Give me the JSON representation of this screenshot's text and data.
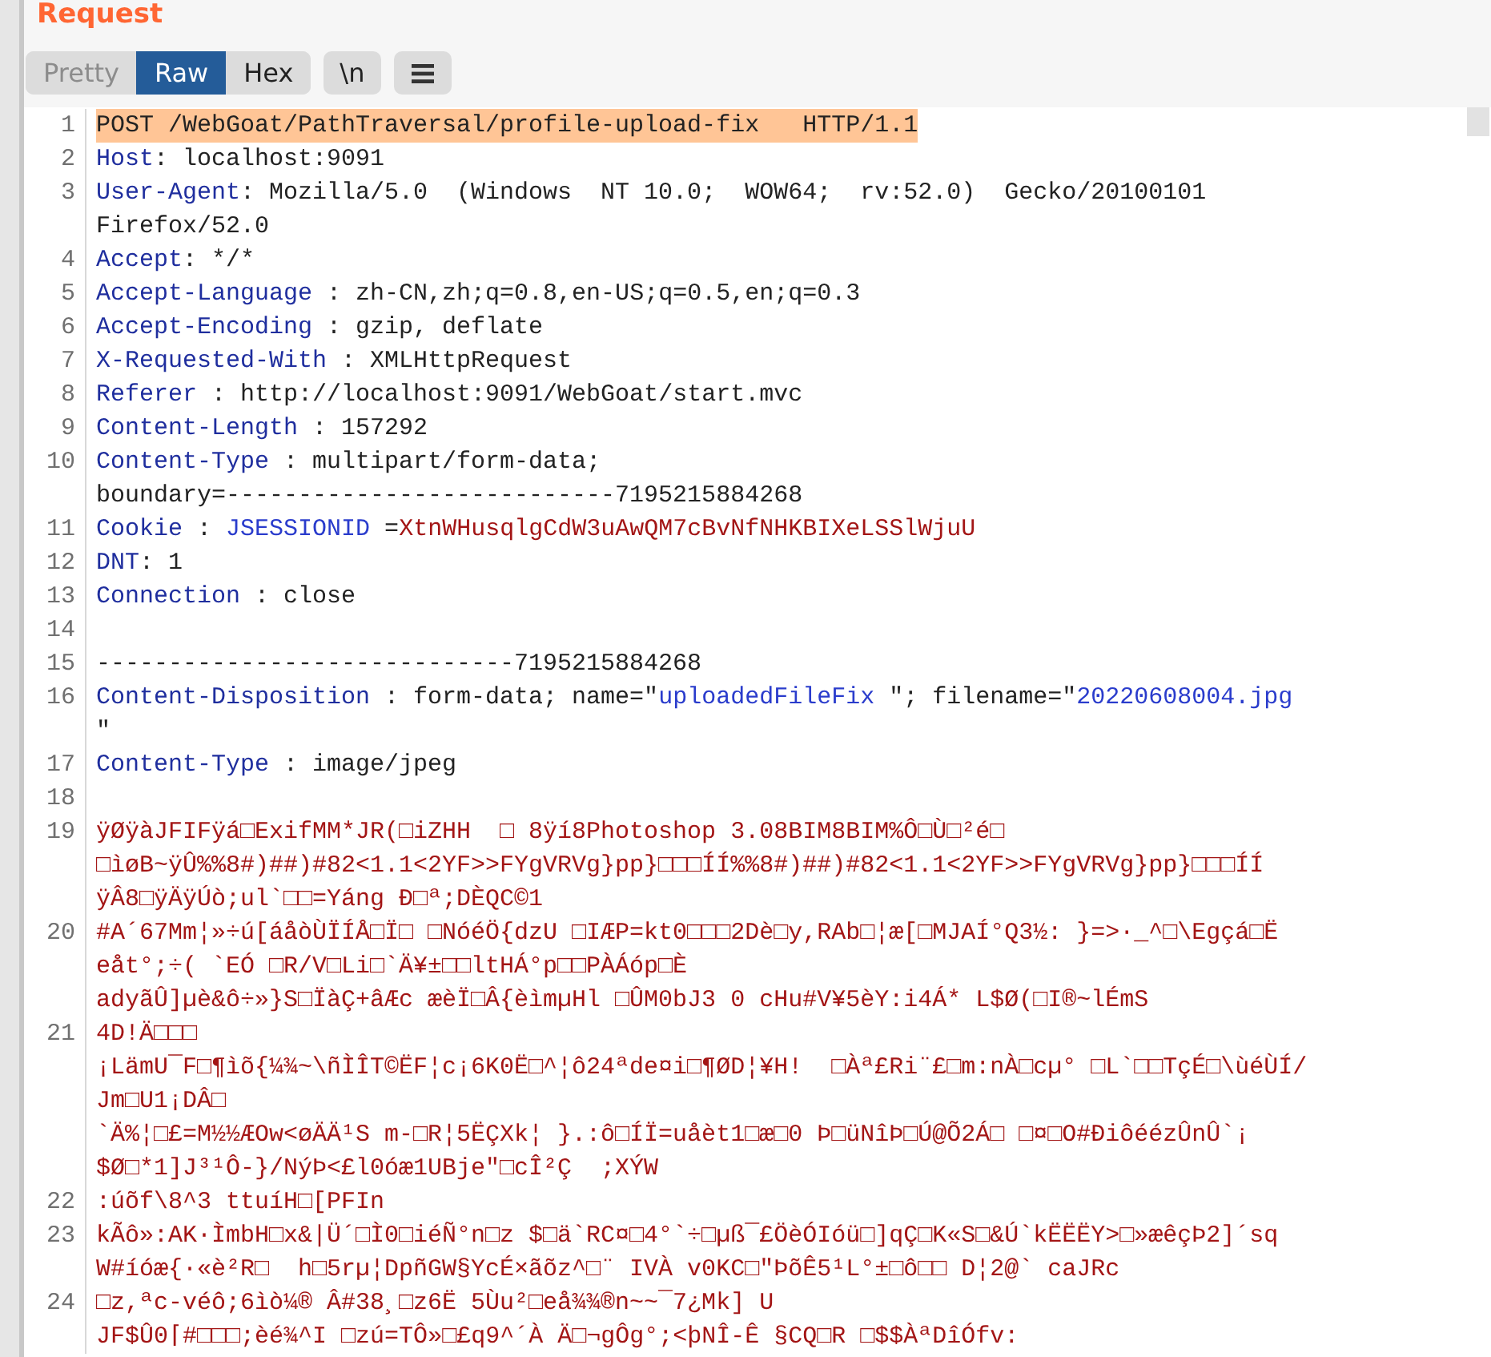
{
  "panel": {
    "title": "Request"
  },
  "view_tabs": [
    {
      "label": "Pretty",
      "selected": false,
      "disabled": true
    },
    {
      "label": "Raw",
      "selected": true,
      "disabled": false
    },
    {
      "label": "Hex",
      "selected": false,
      "disabled": false
    }
  ],
  "newline_button": {
    "label": "\\n"
  },
  "lines": [
    {
      "number": "1",
      "highlighted": true,
      "rows": [
        [
          {
            "kind": "plain",
            "text": "POST /WebGoat/PathTraversal/profile-upload-fix   HTTP/1.1"
          }
        ]
      ]
    },
    {
      "number": "2",
      "highlighted": false,
      "rows": [
        [
          {
            "kind": "key",
            "text": "Host"
          },
          {
            "kind": "plain",
            "text": ": localhost:9091"
          }
        ]
      ]
    },
    {
      "number": "3",
      "highlighted": false,
      "rows": [
        [
          {
            "kind": "key",
            "text": "User-Agent"
          },
          {
            "kind": "plain",
            "text": ": Mozilla/5.0  (Windows  NT 10.0;  WOW64;  rv:52.0)  Gecko/20100101"
          }
        ],
        [
          {
            "kind": "plain",
            "text": "Firefox/52.0"
          }
        ]
      ]
    },
    {
      "number": "4",
      "highlighted": false,
      "rows": [
        [
          {
            "kind": "key",
            "text": "Accept"
          },
          {
            "kind": "plain",
            "text": ": */*"
          }
        ]
      ]
    },
    {
      "number": "5",
      "highlighted": false,
      "rows": [
        [
          {
            "kind": "key",
            "text": "Accept-Language"
          },
          {
            "kind": "plain",
            "text": " : zh-CN,zh;q=0.8,en-US;q=0.5,en;q=0.3"
          }
        ]
      ]
    },
    {
      "number": "6",
      "highlighted": false,
      "rows": [
        [
          {
            "kind": "key",
            "text": "Accept-Encoding"
          },
          {
            "kind": "plain",
            "text": " : gzip, deflate"
          }
        ]
      ]
    },
    {
      "number": "7",
      "highlighted": false,
      "rows": [
        [
          {
            "kind": "key",
            "text": "X-Requested-With"
          },
          {
            "kind": "plain",
            "text": " : XMLHttpRequest"
          }
        ]
      ]
    },
    {
      "number": "8",
      "highlighted": false,
      "rows": [
        [
          {
            "kind": "key",
            "text": "Referer"
          },
          {
            "kind": "plain",
            "text": " : http://localhost:9091/WebGoat/start.mvc"
          }
        ]
      ]
    },
    {
      "number": "9",
      "highlighted": false,
      "rows": [
        [
          {
            "kind": "key",
            "text": "Content-Length"
          },
          {
            "kind": "plain",
            "text": " : 157292"
          }
        ]
      ]
    },
    {
      "number": "10",
      "highlighted": false,
      "rows": [
        [
          {
            "kind": "key",
            "text": "Content-Type"
          },
          {
            "kind": "plain",
            "text": " : multipart/form-data;"
          }
        ],
        [
          {
            "kind": "plain",
            "text": "boundary=---------------------------7195215884268"
          }
        ]
      ]
    },
    {
      "number": "11",
      "highlighted": false,
      "rows": [
        [
          {
            "kind": "key",
            "text": "Cookie"
          },
          {
            "kind": "plain",
            "text": " : "
          },
          {
            "kind": "name",
            "text": "JSESSIONID"
          },
          {
            "kind": "plain",
            "text": " ="
          },
          {
            "kind": "binary",
            "text": "XtnWHusqlgCdW3uAwQM7cBvNfNHKBIXeLSSlWjuU"
          }
        ]
      ]
    },
    {
      "number": "12",
      "highlighted": false,
      "rows": [
        [
          {
            "kind": "key",
            "text": "DNT"
          },
          {
            "kind": "plain",
            "text": ": 1"
          }
        ]
      ]
    },
    {
      "number": "13",
      "highlighted": false,
      "rows": [
        [
          {
            "kind": "key",
            "text": "Connection"
          },
          {
            "kind": "plain",
            "text": " : close"
          }
        ]
      ]
    },
    {
      "number": "14",
      "highlighted": false,
      "rows": [
        []
      ]
    },
    {
      "number": "15",
      "highlighted": false,
      "rows": [
        [
          {
            "kind": "plain",
            "text": "-----------------------------7195215884268"
          }
        ]
      ]
    },
    {
      "number": "16",
      "highlighted": false,
      "rows": [
        [
          {
            "kind": "key",
            "text": "Content-Disposition"
          },
          {
            "kind": "plain",
            "text": " : form-data; name=\""
          },
          {
            "kind": "name",
            "text": "uploadedFileFix "
          },
          {
            "kind": "plain",
            "text": "\"; filename=\""
          },
          {
            "kind": "name",
            "text": "20220608004.jpg"
          }
        ],
        [
          {
            "kind": "plain",
            "text": "\""
          }
        ]
      ]
    },
    {
      "number": "17",
      "highlighted": false,
      "rows": [
        [
          {
            "kind": "key",
            "text": "Content-Type"
          },
          {
            "kind": "plain",
            "text": " : image/jpeg"
          }
        ]
      ]
    },
    {
      "number": "18",
      "highlighted": false,
      "rows": [
        []
      ]
    },
    {
      "number": "19",
      "highlighted": false,
      "rows": [
        [
          {
            "kind": "binary",
            "text": "ÿØÿàJFIFÿá□ExifMM*JR(□iZHH  □ 8ÿí8Photoshop 3.08BIM8BIM%Ô□Ù□²é□"
          }
        ],
        [
          {
            "kind": "binary",
            "text": "□ìøB~ÿÛ%%8#)##)#82<1.1<2YF>>FYgVRVg}pp}□□□ÍÍ%%8#)##)#82<1.1<2YF>>FYgVRVg}pp}□□□ÍÍ"
          }
        ],
        [
          {
            "kind": "binary",
            "text": "ÿÂ8□ÿÄÿÚò;ul`□□=Yáng Ð□ª;DÈQC©1"
          }
        ]
      ]
    },
    {
      "number": "20",
      "highlighted": false,
      "rows": [
        [
          {
            "kind": "binary",
            "text": "#A´67Mm¦»÷ú[áåòÙÏÍÅ□Ï□ □NóéÖ{dzU □IÆP=kt0□□□2Dè□y,RAb□¦æ[□MJAÍ°Q3½: }=>·_^□\\Egçá□Ë"
          }
        ],
        [
          {
            "kind": "binary",
            "text": "eåt°;÷( `EÓ □R/V□Li□`Ä¥±□□ltHÁ°p□□PÀÁóp□È"
          }
        ],
        [
          {
            "kind": "binary",
            "text": "adyãÛ]µè&ô÷»}S□ÏàÇ+âÆc æèÏ□Â{èìmµHl □ÛM0bJ3 0 cHu#V¥5èY:i4Á* L$Ø(□I®~lÉmS"
          }
        ]
      ]
    },
    {
      "number": "21",
      "highlighted": false,
      "rows": [
        [
          {
            "kind": "binary",
            "text": "4D!Ä□□□"
          }
        ],
        [
          {
            "kind": "binary",
            "text": "¡LämU¯F□¶ìõ{¼¾~\\ñÌÎT©ËF¦c¡6K0Ë□^¦ô24ªde¤i□¶ØD¦¥H!  □Àª£Ri¨£□m:nÀ□cµ° □L`□□TçÉ□\\ùéÙÍ/"
          }
        ],
        [
          {
            "kind": "binary",
            "text": "Jm□U1¡DÂ□"
          }
        ],
        [
          {
            "kind": "binary",
            "text": "`Ä%¦□£=M½½ÆOw<øÄÄ¹S m-□R¦5ËÇXk¦ }.:ô□ÍÏ=uåèt1□æ□0 Þ□üNîÞ□Ú@Õ2Á□ □¤□O#ÐiôéézÛnÛ`¡"
          }
        ],
        [
          {
            "kind": "binary",
            "text": "$Ø□*1]J³¹Ô-}/NýÞ<£l0óæ1UBje\"□cÎ²Ç  ;XÝW"
          }
        ]
      ]
    },
    {
      "number": "22",
      "highlighted": false,
      "rows": [
        [
          {
            "kind": "binary",
            "text": ":úõf\\8^3 ttuíH□[PFIn"
          }
        ]
      ]
    },
    {
      "number": "23",
      "highlighted": false,
      "rows": [
        [
          {
            "kind": "binary",
            "text": "kÃô»:AK·ÌmbH□x&|Ü´□Ì0□iéÑ°n□z $□ä`RC¤□4°`÷□µß¯£ÖèÓIóü□]qÇ□K«S□&Ú`kËËËY>□»æêçÞ2]´sq"
          }
        ],
        [
          {
            "kind": "binary",
            "text": "W#íóæ{·«è²R□  h□5rµ¦DpñGW§YcÉ×ãõz^□¨ IVÀ v0KC□\"ÞõÊ5¹L°±□ô□□ D¦2@` caJRc"
          }
        ]
      ]
    },
    {
      "number": "24",
      "highlighted": false,
      "rows": [
        [
          {
            "kind": "binary",
            "text": "□z,ªc-véô;6ìò¼® Â#38¸□z6Ë 5Ùu²□eå¾¾®n~~¯7¿Mk] U"
          }
        ],
        [
          {
            "kind": "binary",
            "text": "JF$Û0⌈#□□□;èé¾^I □zú=TÔ»□£q9^´À Ä□¬gÔg°;<þNÎ-Ê §CQ□R □$$ÀªDîÓfv:"
          }
        ]
      ]
    }
  ]
}
